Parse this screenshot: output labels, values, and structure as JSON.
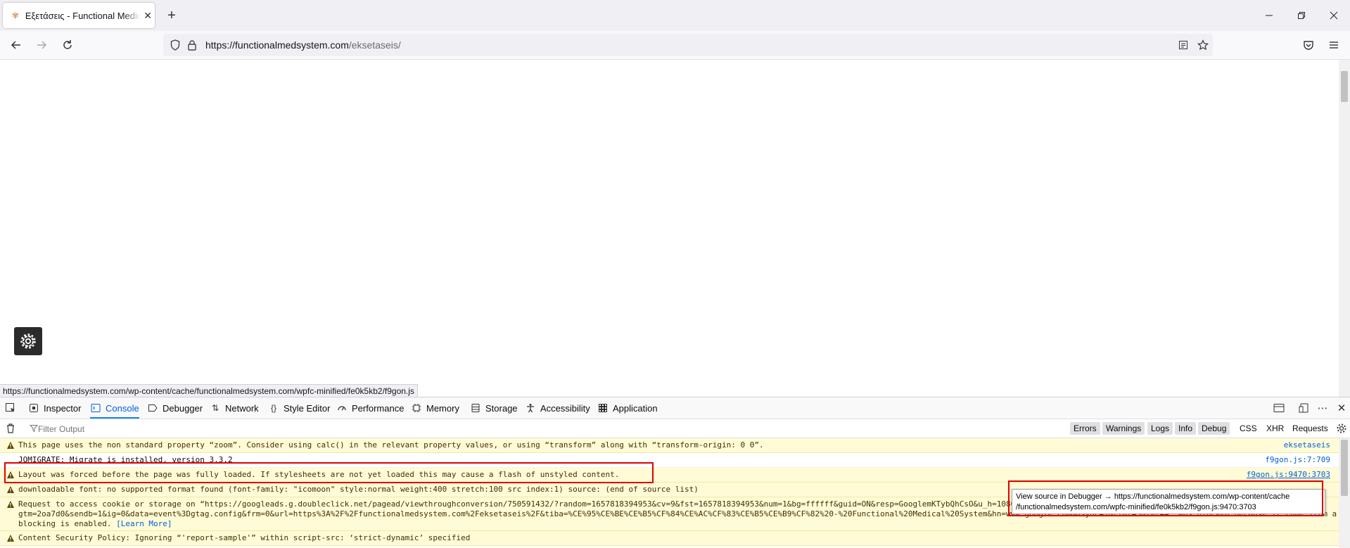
{
  "browser": {
    "tab_title": "Εξετάσεις - Functional Medical System",
    "url_host": "https://functionalmedsystem.com",
    "url_path": "/eksetaseis/",
    "colors": {
      "accent": "#0060df",
      "warning_bg": "#fffbd6",
      "highlight": "#e00000"
    }
  },
  "page": {
    "status_link": "https://functionalmedsystem.com/wp-content/cache/functionalmedsystem.com/wpfc-minified/fe0k5kb2/f9gon.js"
  },
  "devtools": {
    "tabs": [
      {
        "label": "Inspector"
      },
      {
        "label": "Console"
      },
      {
        "label": "Debugger"
      },
      {
        "label": "Network"
      },
      {
        "label": "Style Editor"
      },
      {
        "label": "Performance"
      },
      {
        "label": "Memory"
      },
      {
        "label": "Storage"
      },
      {
        "label": "Accessibility"
      },
      {
        "label": "Application"
      }
    ],
    "selected_tab": "Console",
    "filter_placeholder": "Filter Output",
    "filters": [
      "Errors",
      "Warnings",
      "Logs",
      "Info",
      "Debug",
      "CSS",
      "XHR",
      "Requests"
    ],
    "messages": [
      {
        "type": "warning",
        "text": "This page uses the non standard property “zoom”. Consider using calc() in the relevant property values, or using “transform” along with “transform-origin: 0 0”.",
        "source": "eksetaseis"
      },
      {
        "type": "log",
        "text": "JQMIGRATE: Migrate is installed, version 3.3.2",
        "source": "f9gon.js:7:709"
      },
      {
        "type": "warning",
        "text": "Layout was forced before the page was fully loaded. If stylesheets are not yet loaded this may cause a flash of unstyled content.",
        "source": "f9gon.js:9470:3703"
      },
      {
        "type": "warning",
        "text": "downloadable font: no supported format found (font-family: \"icomoon\" style:normal weight:400 stretch:100 src index:1) source: (end of source list)",
        "source": ""
      },
      {
        "type": "warning",
        "line1": "Request to access cookie or storage on “https://googleads.g.doubleclick.net/pagead/viewthroughconversion/750591432/?random=1657818394953&cv=9&fst=1657818394953&num=1&bg=ffffff&guid=ON&resp=GooglemKTybQhCsO&u_h=1080&u_w=1920&u_ah=1040&",
        "line2": "gtm=2oa7d0&sendb=1&ig=0&data=event%3Dgtag.config&frm=0&url=https%3A%2F%2Ffunctionalmedsystem.com%2Feksetaseis%2F&tiba=%CE%95%CE%BE%CE%B5%CF%84%CE%AC%CF%83%CE%B5%CE%B9%CF%82%20-%20Functional%20Medical%20System&hn=www.google.com&async=1&rfmt=3&fmt=4” was blocked because it came from a tracker and content",
        "line3": "blocking is enabled.",
        "learn_more": "[Learn More]",
        "source": ""
      },
      {
        "type": "warning",
        "text": "Content Security Policy: Ignoring “'report-sample'” within script-src: ‘strict-dynamic’ specified",
        "source": ""
      }
    ],
    "tooltip": {
      "line1": "View source in Debugger → https://functionalmedsystem.com/wp-content/cache",
      "line2": "/functionalmedsystem.com/wpfc-minified/fe0k5kb2/f9gon.js:9470:3703"
    }
  }
}
